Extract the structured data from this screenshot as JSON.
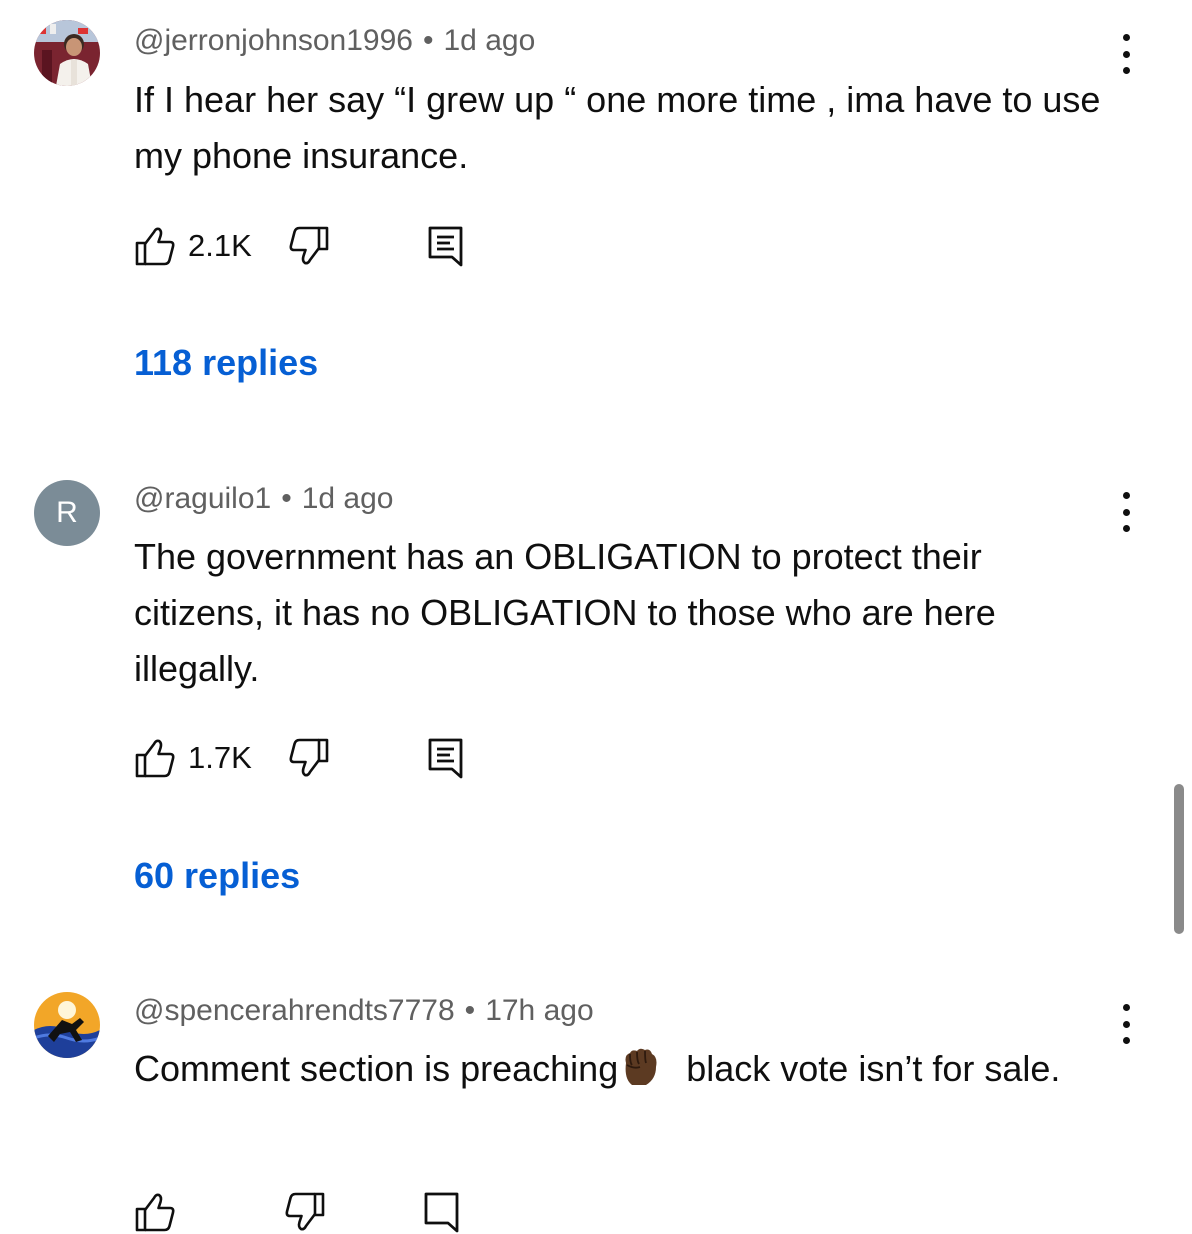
{
  "comments": [
    {
      "author": "@jerronjohnson1996",
      "separator": "•",
      "time": "1d ago",
      "text": "If I hear her say “I grew up “ one more time , ima have to use my phone insurance.",
      "likes": "2.1K",
      "replies": "118 replies",
      "avatar_icon": "photo-avatar"
    },
    {
      "author": "@raguilo1",
      "separator": "•",
      "time": "1d ago",
      "text": "The government has an OBLIGATION to protect their citizens, it has no OBLIGATION to those who are here illegally.",
      "likes": "1.7K",
      "replies": "60 replies",
      "avatar_letter": "R",
      "avatar_color": "#7b8c97"
    },
    {
      "author": "@spencerahrendts7778",
      "separator": "•",
      "time": "17h ago",
      "text_before": "Comment section is preaching",
      "emoji": "raised-fist-dark-skin-tone",
      "text_after": " black vote isn’t for sale.",
      "avatar_icon": "surfer-avatar"
    }
  ],
  "colors": {
    "link": "#065fd4",
    "meta": "#606060",
    "text": "#0f0f0f",
    "scrollbar": "#8a8a8a"
  }
}
